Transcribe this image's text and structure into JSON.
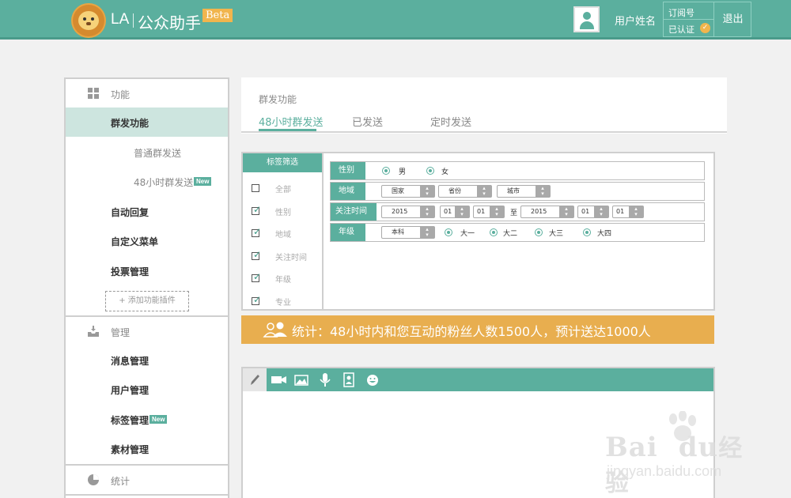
{
  "header": {
    "app_la": "LA",
    "app_name": "公众助手",
    "beta": "Beta",
    "username": "用户姓名",
    "account_type": "订阅号",
    "verified": "已认证",
    "logout": "退出"
  },
  "sidebar": {
    "section_function": "功能",
    "mass_send": "群发功能",
    "normal_send": "普通群发送",
    "send_48h": "48小时群发送",
    "new_badge": "New",
    "auto_reply": "自动回复",
    "custom_menu": "自定义菜单",
    "vote_manage": "投票管理",
    "add_plugin": "+ 添加功能插件",
    "section_manage": "管理",
    "message_manage": "消息管理",
    "user_manage": "用户管理",
    "tag_manage": "标签管理",
    "material_manage": "素材管理",
    "section_stats": "统计"
  },
  "main": {
    "breadcrumb": "群发功能",
    "tabs": [
      "48小时群发送",
      "已发送",
      "定时发送"
    ]
  },
  "filter": {
    "head": "标签筛选",
    "options": [
      {
        "label": "全部",
        "checked": false
      },
      {
        "label": "性别",
        "checked": true
      },
      {
        "label": "地域",
        "checked": true
      },
      {
        "label": "关注时间",
        "checked": true
      },
      {
        "label": "年级",
        "checked": true
      },
      {
        "label": "专业",
        "checked": true
      }
    ],
    "gender": {
      "label": "性别",
      "male": "男",
      "female": "女"
    },
    "region": {
      "label": "地域",
      "country": "国家",
      "province": "省份",
      "city": "城市"
    },
    "follow_time": {
      "label": "关注时间",
      "from_year": "2015",
      "from_month": "01",
      "from_day": "01",
      "to": "至",
      "to_year": "2015",
      "to_month": "01",
      "to_day": "01"
    },
    "grade": {
      "label": "年级",
      "major": "本科",
      "g1": "大一",
      "g2": "大二",
      "g3": "大三",
      "g4": "大四"
    }
  },
  "stats": {
    "text": "统计：48小时内和您互动的粉丝人数1500人，预计送达1000人"
  },
  "watermark": {
    "brand": "Bai",
    "brand2": "du",
    "cn": "经验",
    "url": "jingyan.baidu.com"
  },
  "colors": {
    "accent": "#5baf9e",
    "stat_bar": "#e8ae4f",
    "beta": "#f1b54d"
  }
}
